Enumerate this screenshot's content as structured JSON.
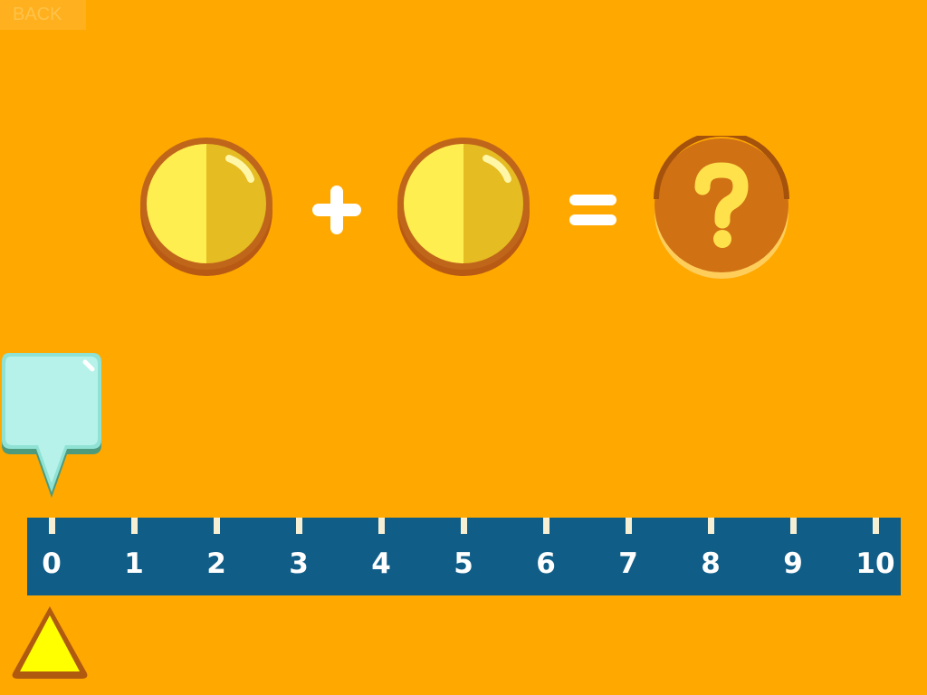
{
  "back_button": {
    "label": "BACK"
  },
  "equation": {
    "left_operand": {
      "kind": "coin",
      "icon": "half-shaded-coin-icon"
    },
    "operator": "+",
    "right_operand": {
      "kind": "coin",
      "icon": "half-shaded-coin-icon"
    },
    "equals": "=",
    "answer": {
      "symbol": "?"
    }
  },
  "number_line": {
    "ticks": [
      "0",
      "1",
      "2",
      "3",
      "4",
      "5",
      "6",
      "7",
      "8",
      "9",
      "10"
    ],
    "marker_value": 0,
    "pointer_value": 0
  },
  "colors": {
    "background": "#FFA800",
    "number_line": "#105E88",
    "coin_light": "#FFEE4F",
    "coin_dark": "#E5BC22",
    "coin_rim": "#C0661A",
    "answer_fill": "#D07114",
    "answer_symbol": "#FFE14C",
    "marker_fill": "#B6F2EA",
    "pointer_fill": "#FFFF00"
  }
}
